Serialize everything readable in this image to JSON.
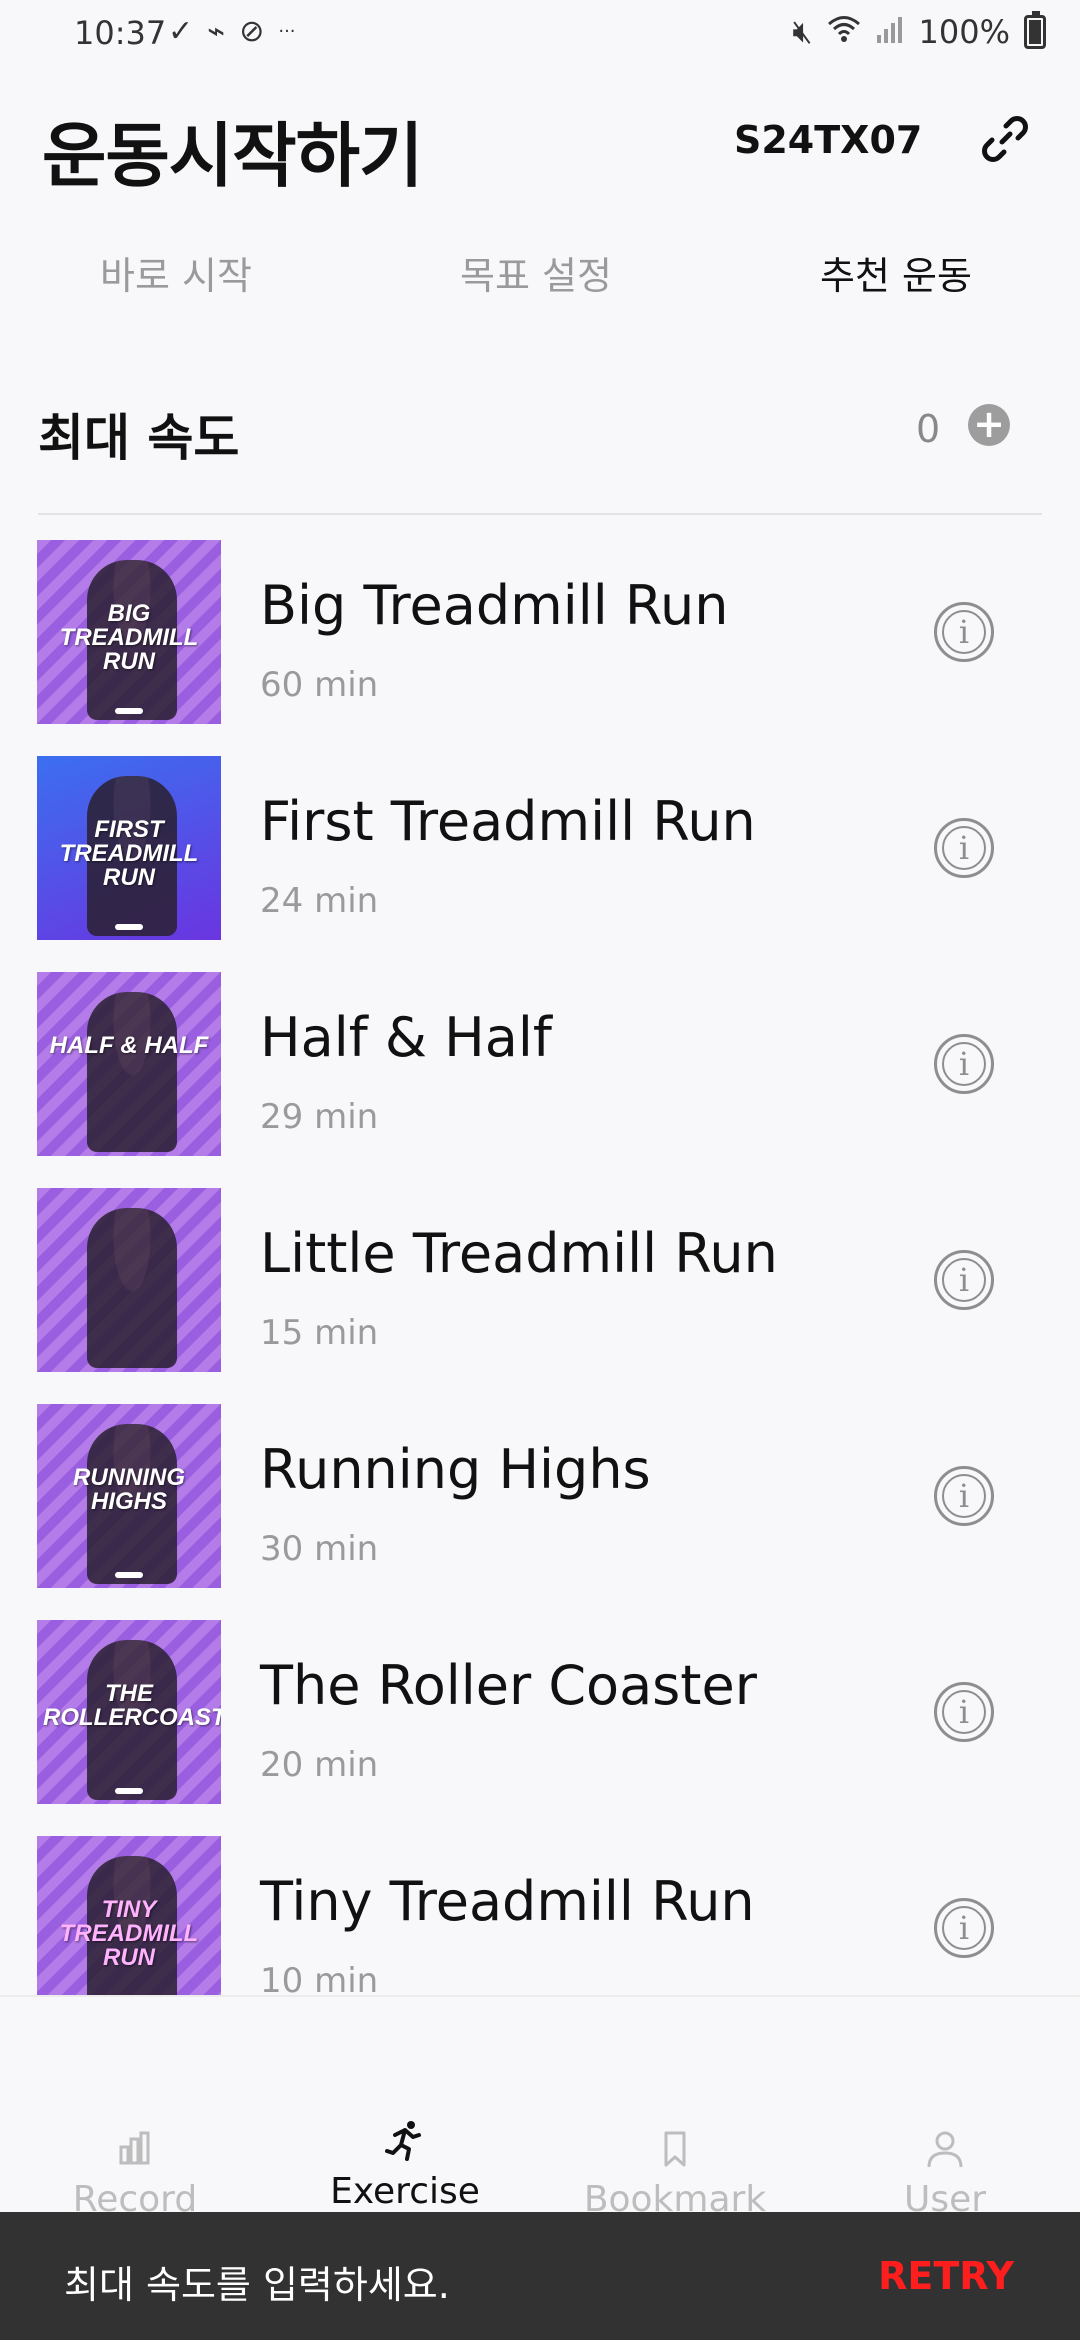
{
  "status_bar": {
    "time": "10:37",
    "battery": "100%"
  },
  "header": {
    "title": "운동시작하기",
    "device_id": "S24TX07"
  },
  "tabs": [
    {
      "label": "바로 시작"
    },
    {
      "label": "목표 설정"
    },
    {
      "label": "추천 운동"
    }
  ],
  "active_tab": 2,
  "section": {
    "title": "최대 속도",
    "count": "0"
  },
  "workouts": [
    {
      "title": "Big Treadmill Run",
      "duration": "60 min",
      "thumb_caption": "BIG TREADMILL RUN"
    },
    {
      "title": "First Treadmill Run",
      "duration": "24 min",
      "thumb_caption": "FIRST TREADMILL RUN"
    },
    {
      "title": "Half & Half",
      "duration": "29 min",
      "thumb_caption": "HALF & HALF"
    },
    {
      "title": "Little Treadmill Run",
      "duration": "15 min",
      "thumb_caption": ""
    },
    {
      "title": "Running Highs",
      "duration": "30 min",
      "thumb_caption": "RUNNING HIGHS"
    },
    {
      "title": "The Roller Coaster",
      "duration": "20 min",
      "thumb_caption": "THE ROLLERCOASTER"
    },
    {
      "title": "Tiny Treadmill Run",
      "duration": "10 min",
      "thumb_caption": "TINY TREADMILL RUN"
    }
  ],
  "nav": [
    {
      "label": "Record",
      "icon": "bar-chart-icon"
    },
    {
      "label": "Exercise",
      "icon": "runner-icon"
    },
    {
      "label": "Bookmark",
      "icon": "bookmark-icon"
    },
    {
      "label": "User",
      "icon": "user-icon"
    }
  ],
  "active_nav": 1,
  "snackbar": {
    "message": "최대 속도를 입력하세요.",
    "action": "RETRY",
    "action_color": "#ff1e1e"
  },
  "colors": {
    "background": "#f8f8fa",
    "thumb_purple": "#9a5fe0",
    "snackbar_bg": "#323232"
  }
}
